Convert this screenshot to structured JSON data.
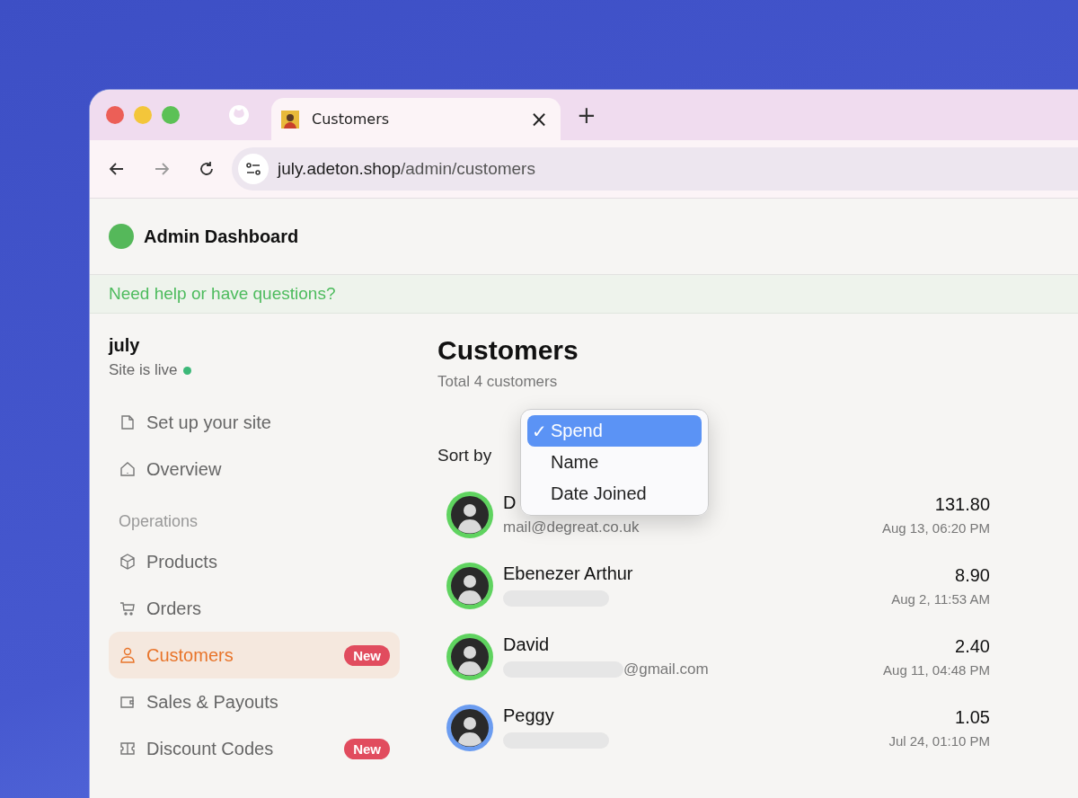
{
  "browser": {
    "tab": {
      "title": "Customers",
      "selected": true
    },
    "close_tab": "×",
    "new_tab": "+",
    "url": {
      "host": "july.adeton.shop",
      "path": "/admin/customers"
    }
  },
  "header": {
    "title": "Admin Dashboard"
  },
  "help_banner": "Need help or have questions?",
  "sidebar": {
    "site_name": "july",
    "status": "Site is live",
    "live": true,
    "items": [
      {
        "kind": "link",
        "label": "Set up your site",
        "selected": false
      },
      {
        "kind": "link",
        "label": "Overview",
        "selected": false
      },
      {
        "kind": "heading",
        "label": "Operations"
      },
      {
        "kind": "link",
        "label": "Products",
        "selected": false
      },
      {
        "kind": "link",
        "label": "Orders",
        "selected": false
      },
      {
        "kind": "link",
        "label": "Customers",
        "selected": true,
        "badge": "New"
      },
      {
        "kind": "link",
        "label": "Sales & Payouts",
        "selected": false
      },
      {
        "kind": "link",
        "label": "Discount Codes",
        "selected": false,
        "badge": "New"
      }
    ]
  },
  "main": {
    "title": "Customers",
    "subtitle": "Total 4 customers",
    "sort_label": "Sort by",
    "sort_menu": {
      "check_mark": "✓",
      "options": [
        {
          "label": "Spend",
          "selected": true
        },
        {
          "label": "Name",
          "selected": false
        },
        {
          "label": "Date Joined",
          "selected": false
        }
      ]
    },
    "customers": [
      {
        "name": "D",
        "email": "mail@degreat.co.uk",
        "email_redacted": false,
        "color": "#5fd35f",
        "spend": "131.80",
        "date": "Aug 13, 06:20 PM"
      },
      {
        "name": "Ebenezer Arthur",
        "email_redacted": true,
        "color": "#5fd35f",
        "spend": "8.90",
        "date": "Aug 2, 11:53 AM"
      },
      {
        "name": "David",
        "email": "@gmail.com",
        "email_redacted": true,
        "color": "#5fd35f",
        "spend": "2.40",
        "date": "Aug 11, 04:48 PM"
      },
      {
        "name": "Peggy",
        "email_redacted": true,
        "color": "#6b9cf0",
        "spend": "1.05",
        "date": "Jul 24, 01:10 PM"
      }
    ]
  }
}
